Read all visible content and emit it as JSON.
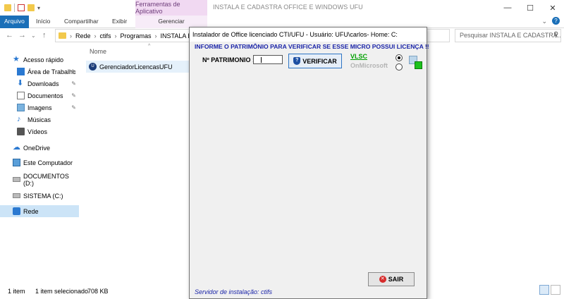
{
  "window": {
    "title": "INSTALA E CADASTRA OFFICE E WINDOWS UFU",
    "context_tab": "Ferramentas de Aplicativo",
    "context_subtab": "Gerenciar"
  },
  "ribbon": {
    "tabs": [
      "Arquivo",
      "Início",
      "Compartilhar",
      "Exibir"
    ]
  },
  "address": {
    "path": [
      "Rede",
      "ctifs",
      "Programas",
      "INSTALA E"
    ],
    "search_placeholder": "Pesquisar INSTALA E CADASTRA..."
  },
  "sidebar": {
    "items": [
      {
        "label": "Acesso rápido",
        "icon": "star-icon"
      },
      {
        "label": "Área de Trabalhc",
        "icon": "desktop-icon"
      },
      {
        "label": "Downloads",
        "icon": "download-icon"
      },
      {
        "label": "Documentos",
        "icon": "document-icon"
      },
      {
        "label": "Imagens",
        "icon": "image-icon"
      },
      {
        "label": "Músicas",
        "icon": "music-icon"
      },
      {
        "label": "Vídeos",
        "icon": "video-icon"
      },
      {
        "label": "OneDrive",
        "icon": "cloud-icon"
      },
      {
        "label": "Este Computador",
        "icon": "computer-icon"
      },
      {
        "label": "DOCUMENTOS (D:)",
        "icon": "drive-icon"
      },
      {
        "label": "SISTEMA (C:)",
        "icon": "drive-icon"
      },
      {
        "label": "Rede",
        "icon": "network-icon"
      }
    ]
  },
  "filelist": {
    "column_name": "Nome",
    "files": [
      {
        "name": "GerenciadorLicencasUFU"
      }
    ]
  },
  "status": {
    "count": "1 item",
    "selected": "1 item selecionado",
    "size": "708 KB"
  },
  "dialog": {
    "title": "Instalador de Office licenciado CTI/UFU - Usuário: UFU\\carlos- Home: C:",
    "heading": "INFORME O PATRIMÔNIO PARA VERIFICAR SE ESSE MICRO POSSUI LICENÇA !!",
    "patrimonio_label": "Nº PATRIMONIO :",
    "verify_button": "VERIFICAR",
    "option_vlsc": "VLSC",
    "option_onmicrosoft": "OnMicrosoft",
    "exit_button": "SAIR",
    "server_text": "Servidor de instalação: ctifs"
  },
  "colors": {
    "accent": "#1a6fb8",
    "context_tab_bg": "#f1d9f2",
    "heading_blue": "#1a24a8",
    "vlsc_green": "#00a000"
  }
}
